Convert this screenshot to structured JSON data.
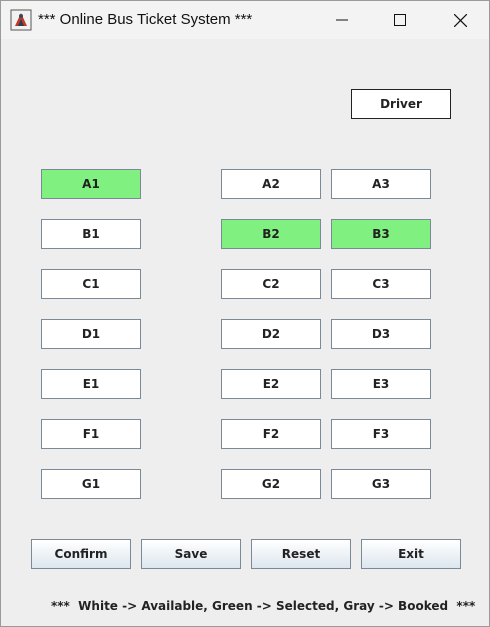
{
  "window": {
    "title": "*** Online Bus Ticket System ***"
  },
  "driver_label": "Driver",
  "seats": {
    "A1": {
      "label": "A1",
      "state": "selected"
    },
    "A2": {
      "label": "A2",
      "state": "available"
    },
    "A3": {
      "label": "A3",
      "state": "available"
    },
    "B1": {
      "label": "B1",
      "state": "available"
    },
    "B2": {
      "label": "B2",
      "state": "selected"
    },
    "B3": {
      "label": "B3",
      "state": "selected"
    },
    "C1": {
      "label": "C1",
      "state": "available"
    },
    "C2": {
      "label": "C2",
      "state": "available"
    },
    "C3": {
      "label": "C3",
      "state": "available"
    },
    "D1": {
      "label": "D1",
      "state": "available"
    },
    "D2": {
      "label": "D2",
      "state": "available"
    },
    "D3": {
      "label": "D3",
      "state": "available"
    },
    "E1": {
      "label": "E1",
      "state": "available"
    },
    "E2": {
      "label": "E2",
      "state": "available"
    },
    "E3": {
      "label": "E3",
      "state": "available"
    },
    "F1": {
      "label": "F1",
      "state": "available"
    },
    "F2": {
      "label": "F2",
      "state": "available"
    },
    "F3": {
      "label": "F3",
      "state": "available"
    },
    "G1": {
      "label": "G1",
      "state": "available"
    },
    "G2": {
      "label": "G2",
      "state": "available"
    },
    "G3": {
      "label": "G3",
      "state": "available"
    }
  },
  "actions": {
    "confirm": "Confirm",
    "save": "Save",
    "reset": "Reset",
    "exit": "Exit"
  },
  "legend": "***  White -> Available, Green -> Selected, Gray -> Booked  ***",
  "colors": {
    "available": "#ffffff",
    "selected": "#80f080"
  }
}
